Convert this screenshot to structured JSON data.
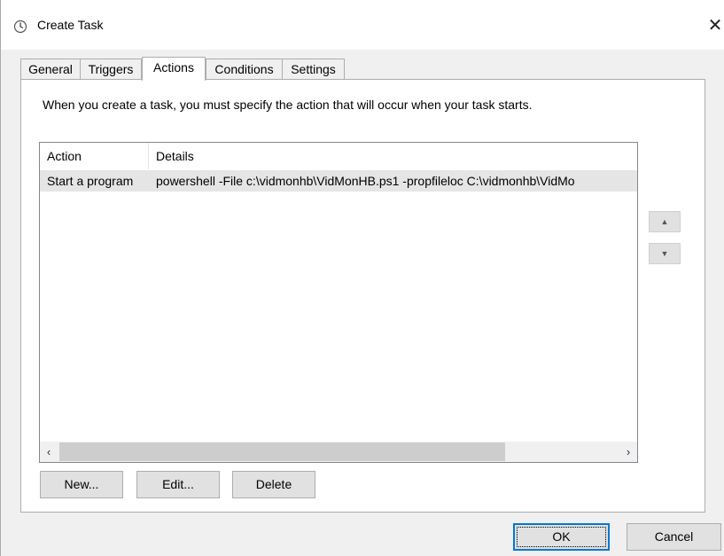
{
  "window": {
    "title": "Create Task",
    "close_glyph": "✕"
  },
  "tabs": [
    {
      "label": "General",
      "active": false
    },
    {
      "label": "Triggers",
      "active": false
    },
    {
      "label": "Actions",
      "active": true
    },
    {
      "label": "Conditions",
      "active": false
    },
    {
      "label": "Settings",
      "active": false
    }
  ],
  "actions_tab": {
    "intro": "When you create a task, you must specify the action that will occur when your task starts.",
    "list": {
      "columns": [
        "Action",
        "Details"
      ],
      "rows": [
        {
          "action": "Start a program",
          "details": "powershell -File c:\\vidmonhb\\VidMonHB.ps1 -propfileloc C:\\vidmonhb\\VidMo"
        }
      ]
    },
    "scroll_left_glyph": "‹",
    "scroll_right_glyph": "›",
    "move_up_glyph": "▲",
    "move_down_glyph": "▼",
    "buttons": {
      "new": "New...",
      "edit": "Edit...",
      "delete": "Delete"
    }
  },
  "footer": {
    "ok": "OK",
    "cancel": "Cancel"
  },
  "icons": {
    "title_icon": "clock-icon",
    "close": "close-icon",
    "up": "arrow-up-icon",
    "down": "arrow-down-icon"
  },
  "colors": {
    "accent": "#0078d7",
    "selected_row": "#e5e5e5",
    "button_face": "#e1e1e1"
  }
}
